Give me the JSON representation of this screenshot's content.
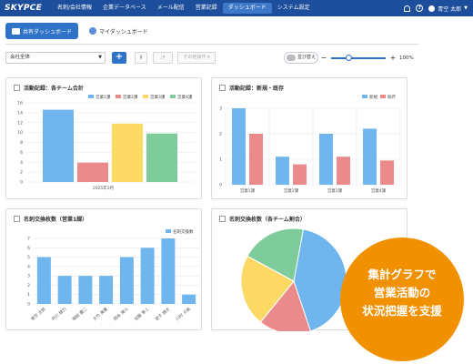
{
  "header": {
    "logo": "SKYPCE",
    "nav": [
      "名刺/会社情報",
      "企業データベース",
      "メール配信",
      "営業記録",
      "ダッシュボード",
      "システム設定"
    ],
    "active_nav": "ダッシュボード",
    "user_name": "青空 太郎",
    "bell_icon": "bell-icon",
    "help_icon": "help-icon"
  },
  "tabs": [
    {
      "label": "共有ダッシュボード",
      "active": true
    },
    {
      "label": "マイダッシュボード",
      "active": false
    }
  ],
  "toolbar": {
    "scope_select": "会社全体",
    "add_label": "+",
    "other_ops": "その他操作",
    "sort_toggle": "並び替え",
    "zoom_minus": "−",
    "zoom_plus": "+",
    "zoom_value": "100%",
    "zoom_level": 0.33
  },
  "cards": {
    "c1": {
      "title": "活動記録：各チーム合計"
    },
    "c2": {
      "title": "活動記録：新規・既存"
    },
    "c3": {
      "title": "名刺交換枚数（営業1課）"
    },
    "c4": {
      "title": "名刺交換枚数（各チーム割合）"
    }
  },
  "colors": {
    "blue": "#6fb6ee",
    "red": "#ea8a8a",
    "yellow": "#fbd964",
    "green": "#7ecc9c",
    "header": "#1c4e9c",
    "accent": "#2f73c8",
    "badge": "#f29100"
  },
  "chart_data": [
    {
      "type": "bar",
      "categories": [
        "2025年3月"
      ],
      "series": [
        {
          "name": "営業1課",
          "values": [
            14.6
          ]
        },
        {
          "name": "営業2課",
          "values": [
            3.9
          ]
        },
        {
          "name": "営業3課",
          "values": [
            11.8
          ]
        },
        {
          "name": "営業4課",
          "values": [
            9.8
          ]
        }
      ],
      "ylim": [
        0,
        16
      ],
      "yticks": [
        0,
        2,
        4,
        6,
        8,
        10,
        12,
        14,
        16
      ],
      "legend": "top-right"
    },
    {
      "type": "bar",
      "categories": [
        "営業1課",
        "営業2課",
        "営業3課",
        "営業4課"
      ],
      "series": [
        {
          "name": "新規",
          "values": [
            3,
            1.1,
            2,
            2.2
          ]
        },
        {
          "name": "既存",
          "values": [
            2,
            0.8,
            1.1,
            0.95
          ]
        }
      ],
      "ylim": [
        0,
        3
      ],
      "yticks": [
        0,
        1,
        2,
        3
      ],
      "legend": "top-right"
    },
    {
      "type": "bar",
      "categories": [
        "青空 太郎",
        "井川 健力",
        "細田 慶二",
        "大竹 美重",
        "岡本 陽斗",
        "加藤 隼人",
        "波子 健太",
        "川村 夕実"
      ],
      "series": [
        {
          "name": "名刺交換数",
          "values": [
            5,
            3,
            3,
            3,
            5,
            6,
            7,
            1
          ]
        }
      ],
      "ylim": [
        0,
        7
      ],
      "yticks": [
        0,
        1,
        2,
        3,
        4,
        5,
        6,
        7
      ],
      "legend": "top-right"
    },
    {
      "type": "pie",
      "values": [
        42,
        16,
        22,
        20
      ],
      "colors": [
        "#6fb6ee",
        "#ea8a8a",
        "#fbd964",
        "#7ecc9c"
      ]
    }
  ],
  "badge": {
    "line1": "集計グラフで",
    "line2": "営業活動の",
    "line3": "状況把握を支援"
  }
}
